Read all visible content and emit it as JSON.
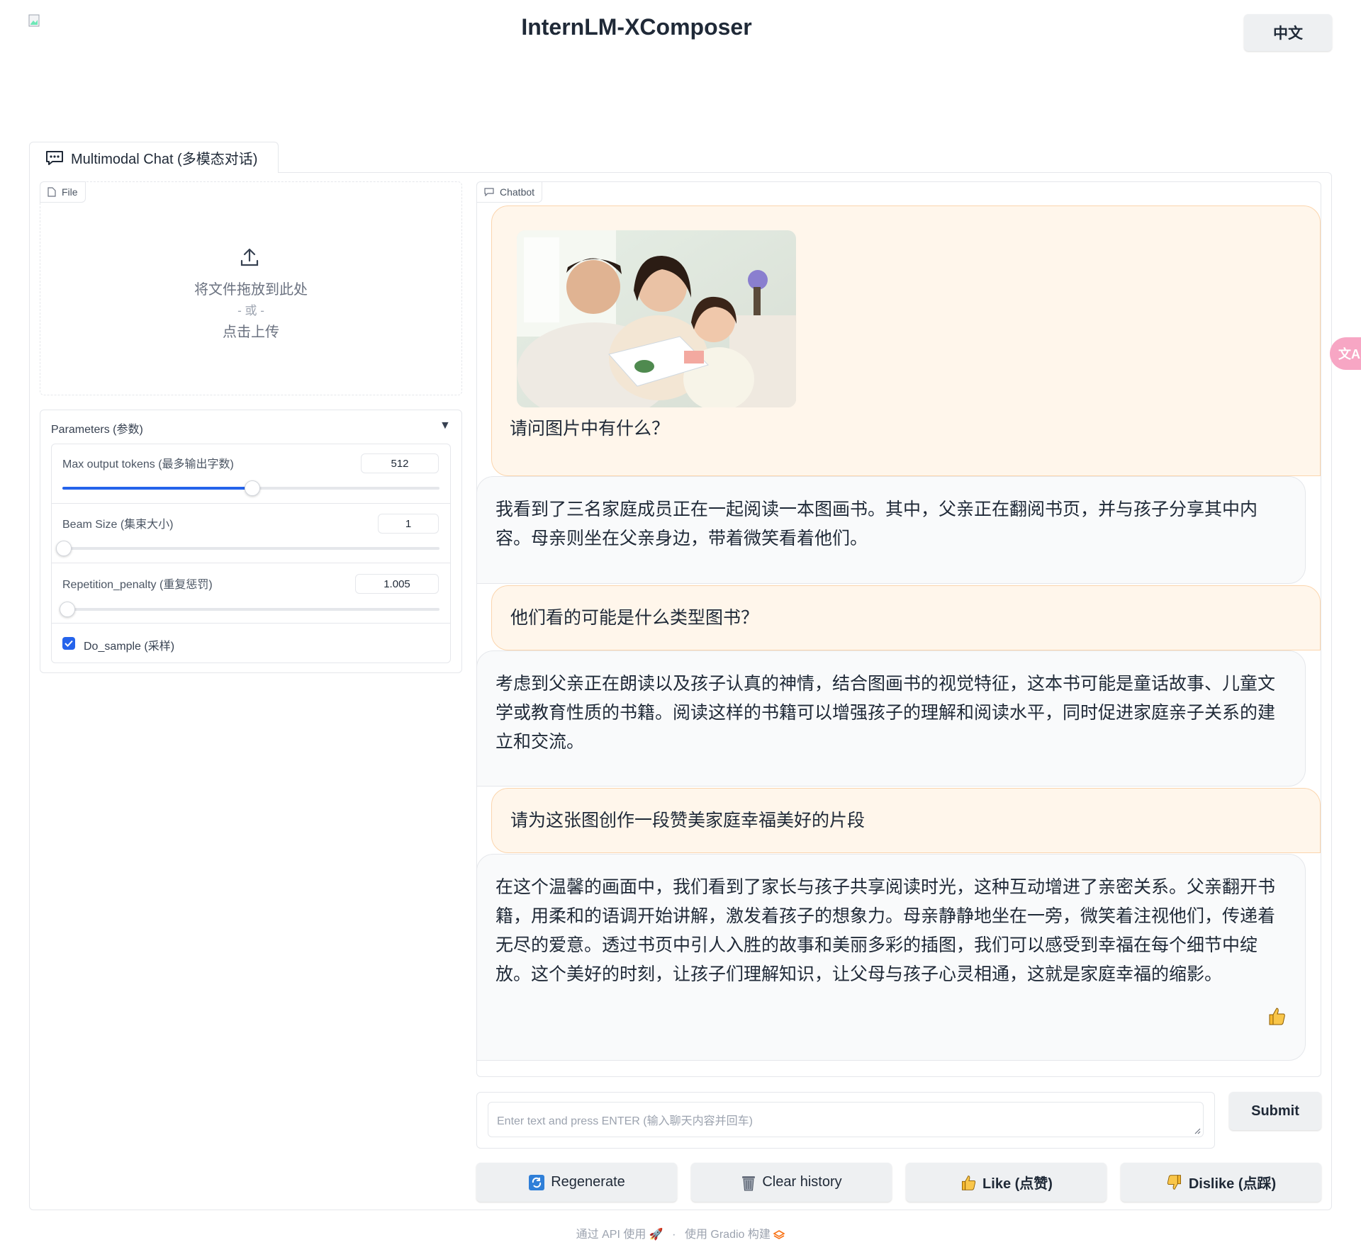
{
  "header": {
    "title": "InternLM-XComposer",
    "language_button": "中文"
  },
  "tabs": [
    {
      "label": "Multimodal Chat (多模态对话)",
      "icon": "chat-bubble-icon"
    }
  ],
  "file_upload": {
    "label": "File",
    "drop_text": "将文件拖放到此处",
    "or_text": "- 或 -",
    "click_text": "点击上传"
  },
  "parameters": {
    "title": "Parameters (参数)",
    "max_tokens": {
      "label": "Max output tokens (最多输出字数)",
      "value": "512",
      "slider_fraction": 0.5
    },
    "beam_size": {
      "label": "Beam Size (集束大小)",
      "value": "1",
      "slider_fraction": 0.0
    },
    "repetition_penalty": {
      "label": "Repetition_penalty (重复惩罚)",
      "value": "1.005",
      "slider_fraction": 0.01
    },
    "do_sample": {
      "label": "Do_sample (采样)",
      "checked": true
    }
  },
  "chatbot": {
    "label": "Chatbot",
    "messages": [
      {
        "role": "user",
        "text": "请问图片中有什么？",
        "has_image": true
      },
      {
        "role": "bot",
        "text": "我看到了三名家庭成员正在一起阅读一本图画书。其中，父亲正在翻阅书页，并与孩子分享其中内容。母亲则坐在父亲身边，带着微笑看着他们。"
      },
      {
        "role": "user",
        "text": "他们看的可能是什么类型图书？"
      },
      {
        "role": "bot",
        "text": "考虑到父亲正在朗读以及孩子认真的神情，结合图画书的视觉特征，这本书可能是童话故事、儿童文学或教育性质的书籍。阅读这样的书籍可以增强孩子的理解和阅读水平，同时促进家庭亲子关系的建立和交流。"
      },
      {
        "role": "user",
        "text": "请为这张图创作一段赞美家庭幸福美好的片段"
      },
      {
        "role": "bot",
        "text": "在这个温馨的画面中，我们看到了家长与孩子共享阅读时光，这种互动增进了亲密关系。父亲翻开书籍，用柔和的语调开始讲解，激发着孩子的想象力。母亲静静地坐在一旁，微笑着注视他们，传递着无尽的爱意。透过书页中引人入胜的故事和美丽多彩的插图，我们可以感受到幸福在每个细节中绽放。这个美好的时刻，让孩子们理解知识，让父母与孩子心灵相通，这就是家庭幸福的缩影。",
        "liked": true
      }
    ]
  },
  "input": {
    "placeholder": "Enter text and press ENTER (输入聊天内容并回车)",
    "submit_label": "Submit"
  },
  "actions": {
    "regenerate": "Regenerate",
    "clear_history": "Clear history",
    "like": "Like (点赞)",
    "dislike": "Dislike (点踩)"
  },
  "footer": {
    "api_text": "通过 API 使用",
    "separator": "·",
    "built_with": "使用 Gradio 构建"
  },
  "colors": {
    "accent": "#2563eb",
    "user_bubble": "#fff6eb",
    "bot_bubble": "#f9fafb",
    "button_bg": "#eef0f2",
    "translate_fab": "#f7a6c4"
  }
}
